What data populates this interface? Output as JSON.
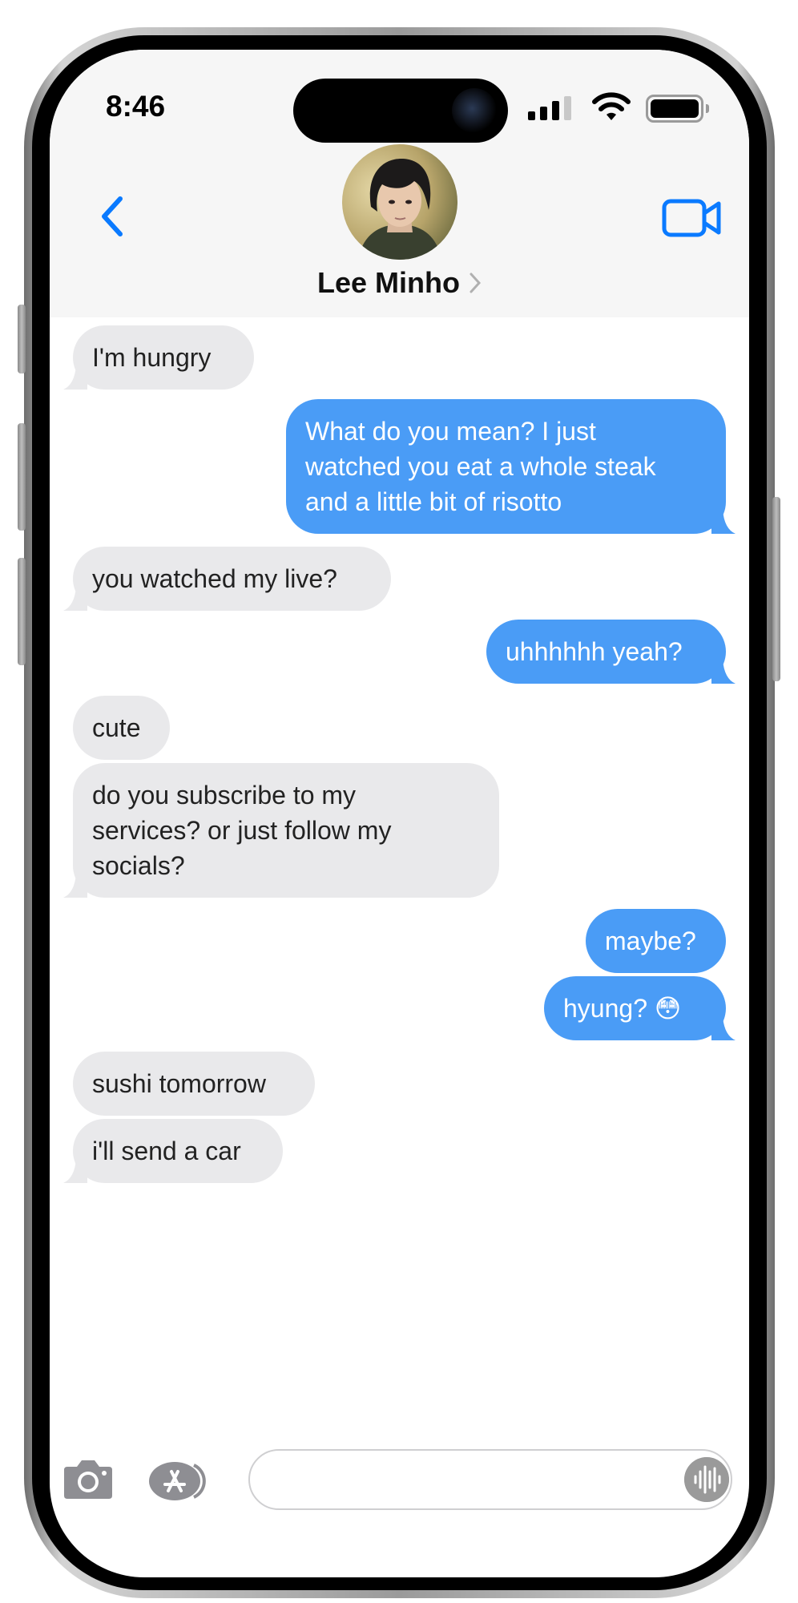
{
  "status_bar": {
    "time": "8:46"
  },
  "header": {
    "contact_name": "Lee Minho"
  },
  "messages": [
    {
      "from": "them",
      "text": "I'm hungry"
    },
    {
      "from": "me",
      "lines": [
        "What do you mean? I just",
        "watched you eat a whole steak",
        "and a little bit of risotto"
      ]
    },
    {
      "from": "them",
      "text": "you watched my live?"
    },
    {
      "from": "me",
      "text": "uhhhhhh yeah?"
    },
    {
      "from": "them",
      "text": "cute"
    },
    {
      "from": "them",
      "lines": [
        "do you subscribe to my",
        "services? or just follow my",
        "socials?"
      ]
    },
    {
      "from": "me",
      "text": "maybe?"
    },
    {
      "from": "me",
      "text": "hyung? 😳"
    },
    {
      "from": "them",
      "text": "sushi tomorrow"
    },
    {
      "from": "them",
      "text": "i'll send a car"
    }
  ],
  "composer": {
    "value": "",
    "placeholder": ""
  },
  "icons": {
    "back": "chevron-left-icon",
    "video": "video-camera-icon",
    "camera": "camera-icon",
    "apps": "app-store-icon",
    "audio": "audio-waveform-icon"
  },
  "colors": {
    "sent_bubble": "#4a9cf6",
    "received_bubble": "#e9e9eb",
    "accent": "#0a7aff",
    "header_bg": "#f6f6f6"
  }
}
